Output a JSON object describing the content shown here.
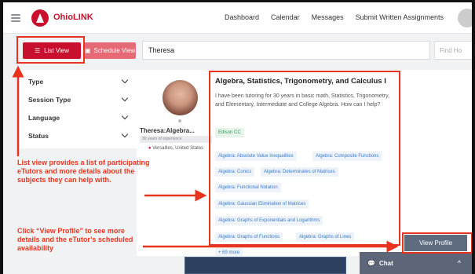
{
  "header": {
    "logo": "OhioLINK",
    "nav": [
      "Dashboard",
      "Calendar",
      "Messages",
      "Submit Written Assignments"
    ]
  },
  "toolbar": {
    "list_view": "List View",
    "schedule_view": "Schedule View",
    "search_value": "Theresa",
    "find_placeholder": "Find Ho"
  },
  "filters": [
    "Type",
    "Session Type",
    "Language",
    "Status"
  ],
  "tutor": {
    "name": "Theresa:Algebra...",
    "experience": "30 years of experience",
    "location": "Versailles, United States",
    "subject_title": "Algebra, Statistics, Trigonometry, and Calculus I",
    "description": "I have been tutoring for 30 years in basic math, Statistics, Trigonometry, and Elementary, Intermediate and College Algebra. How can I help?",
    "org": "Edison CC",
    "tags": [
      "Algebra: Absolute Value Inequalities",
      "Algebra: Composite Functions",
      "Algebra: Conics",
      "Algebra: Determinates of Matrices",
      "Algebra: Functional Notation",
      "Algebra: Gaussian Elimination of Matrices",
      "Algebra: Graphs of Exponentials and Logarithms",
      "Algebra: Graphs of Functions",
      "Algebra: Graphs of Lines"
    ],
    "more": "+ 69 more",
    "view_profile": "View Profile"
  },
  "chat": {
    "label": "Chat"
  },
  "annotations": {
    "list_view_note": "List view provides a list of participating eTutors and more details about the subjects they can help with.",
    "view_profile_note": "Click “View Profile” to see more details and the eTutor’s scheduled availability"
  },
  "colors": {
    "brand": "#c8102e",
    "annotation": "#e8341f",
    "tag_text": "#3b7bc7",
    "button": "#5f6c80"
  }
}
